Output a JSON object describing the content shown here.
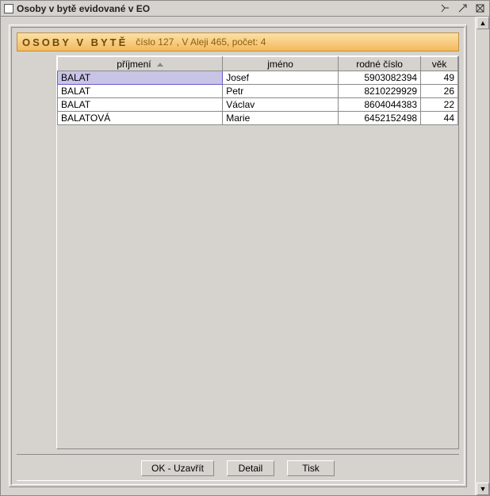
{
  "window": {
    "title": "Osoby v bytě evidované v EO"
  },
  "header": {
    "title": "OSOBY V BYTĚ",
    "subtitle": "číslo 127 , V Aleji 465,  počet: 4"
  },
  "table": {
    "columns": {
      "surname": "příjmení",
      "name": "jméno",
      "id": "rodné číslo",
      "age": "věk"
    },
    "rows": [
      {
        "surname": "BALAT",
        "name": "Josef",
        "id": "5903082394",
        "age": "49"
      },
      {
        "surname": "BALAT",
        "name": "Petr",
        "id": "8210229929",
        "age": "26"
      },
      {
        "surname": "BALAT",
        "name": "Václav",
        "id": "8604044383",
        "age": "22"
      },
      {
        "surname": "BALATOVÁ",
        "name": "Marie",
        "id": "6452152498",
        "age": "44"
      }
    ]
  },
  "buttons": {
    "ok": "OK - Uzavřít",
    "detail": "Detail",
    "print": "Tisk"
  }
}
